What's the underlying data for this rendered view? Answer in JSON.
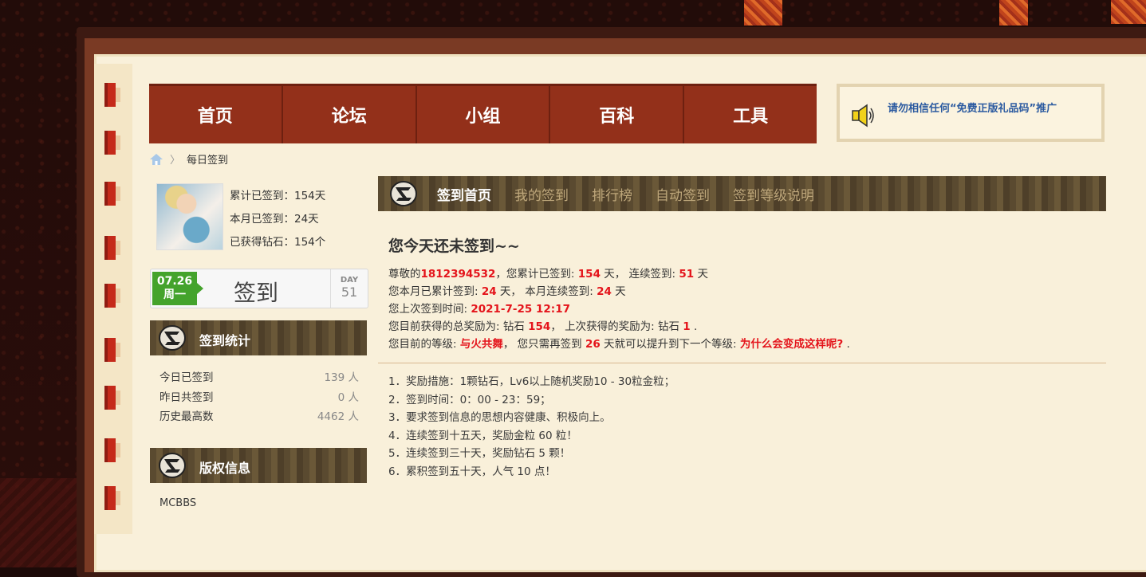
{
  "nav": {
    "items": [
      "首页",
      "论坛",
      "小组",
      "百科",
      "工具"
    ]
  },
  "notice": {
    "text": "请勿相信任何“免费正版礼品码”推广"
  },
  "breadcrumb": {
    "current": "每日签到",
    "separator": "〉"
  },
  "profile": {
    "total": "累计已签到：154天",
    "month": "本月已签到：24天",
    "diamonds": "已获得钻石：154个"
  },
  "signbox": {
    "date": "07.26",
    "weekday": "周一",
    "label": "签到",
    "day_label": "DAY",
    "day_value": "51"
  },
  "stats_panel": {
    "title": "签到统计",
    "rows": [
      {
        "label": "今日已签到",
        "value": "139 人"
      },
      {
        "label": "昨日共签到",
        "value": "0 人"
      },
      {
        "label": "历史最高数",
        "value": "4462 人"
      }
    ]
  },
  "copyright_panel": {
    "title": "版权信息",
    "text": "MCBBS"
  },
  "tabs": [
    "签到首页",
    "我的签到",
    "排行榜",
    "自动签到",
    "签到等级说明"
  ],
  "main": {
    "title": "您今天还未签到~~",
    "l1": {
      "a": "尊敬的",
      "user": "1812394532",
      "b": "，您累计已签到: ",
      "total": "154",
      "c": " 天， 连续签到: ",
      "streak": "51",
      "d": " 天"
    },
    "l2": {
      "a": "您本月已累计签到: ",
      "month": "24",
      "b": " 天， 本月连续签到: ",
      "mstreak": "24",
      "c": " 天"
    },
    "l3": {
      "a": "您上次签到时间: ",
      "time": "2021-7-25 12:17"
    },
    "l4": {
      "a": "您目前获得的总奖励为: 钻石 ",
      "total": "154",
      "b": "， 上次获得的奖励为: 钻石 ",
      "last": "1",
      "c": " ."
    },
    "l5": {
      "a": "您目前的等级: ",
      "level": "与火共舞",
      "b": "， 您只需再签到 ",
      "need": "26",
      "c": " 天就可以提升到下一个等级: ",
      "next": "为什么会变成这样呢?",
      "d": " ."
    }
  },
  "rules": [
    "1．奖励措施：1颗钻石，Lv6以上随机奖励10 - 30粒金粒；",
    "2．签到时间：0：00 - 23：59；",
    "3．要求签到信息的思想内容健康、积极向上。",
    "4．连续签到十五天，奖励金粒 60 粒！",
    "5．连续签到三十天，奖励钻石 5 颗！",
    "6．累积签到五十天，人气 10 点！"
  ]
}
